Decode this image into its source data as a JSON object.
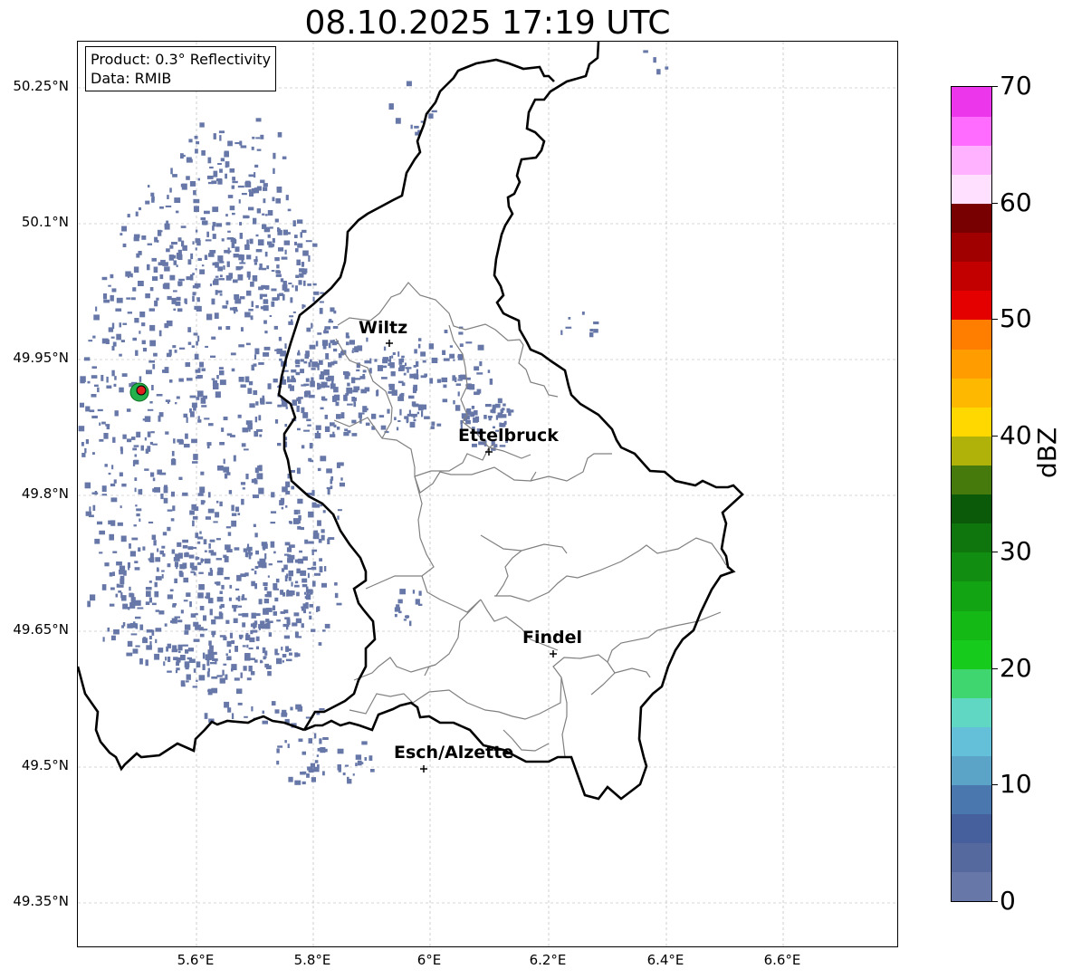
{
  "title": "08.10.2025 17:19 UTC",
  "info": {
    "product": "Product: 0.3° Reflectivity",
    "data": "Data: RMIB"
  },
  "lat_ticks": [
    "50.25°N",
    "50.1°N",
    "49.95°N",
    "49.8°N",
    "49.65°N",
    "49.5°N",
    "49.35°N"
  ],
  "lon_ticks": [
    "5.6°E",
    "5.8°E",
    "6°E",
    "6.2°E",
    "6.4°E",
    "6.6°E"
  ],
  "cities": [
    {
      "name": "Wiltz"
    },
    {
      "name": "Ettelbruck"
    },
    {
      "name": "Findel"
    },
    {
      "name": "Esch/Alzette"
    }
  ],
  "colorbar": {
    "label": "dBZ",
    "ticks": [
      "0",
      "10",
      "20",
      "30",
      "40",
      "50",
      "60",
      "70"
    ],
    "range": [
      0,
      70
    ],
    "step": 2.5,
    "colors": [
      "#6677a8",
      "#56699e",
      "#45609d",
      "#4a77ad",
      "#5ba3c7",
      "#64c0d9",
      "#5fd7c3",
      "#3fd66f",
      "#16cb1c",
      "#14b916",
      "#13a414",
      "#118e11",
      "#0f760e",
      "#0a5a09",
      "#477a0d",
      "#b0b20a",
      "#ffd800",
      "#ffb800",
      "#ff9c00",
      "#ff7e00",
      "#e50000",
      "#c20000",
      "#a00000",
      "#780000",
      "#ffe0ff",
      "#ffb2ff",
      "#ff6cff",
      "#ec36ec"
    ]
  },
  "colors": {
    "echo": "#6677a8",
    "border": "#000000",
    "district": "#808080",
    "grid": "#b0b0b0",
    "radar_site_outer": "#22b14c",
    "radar_site_inner": "#e02020"
  }
}
